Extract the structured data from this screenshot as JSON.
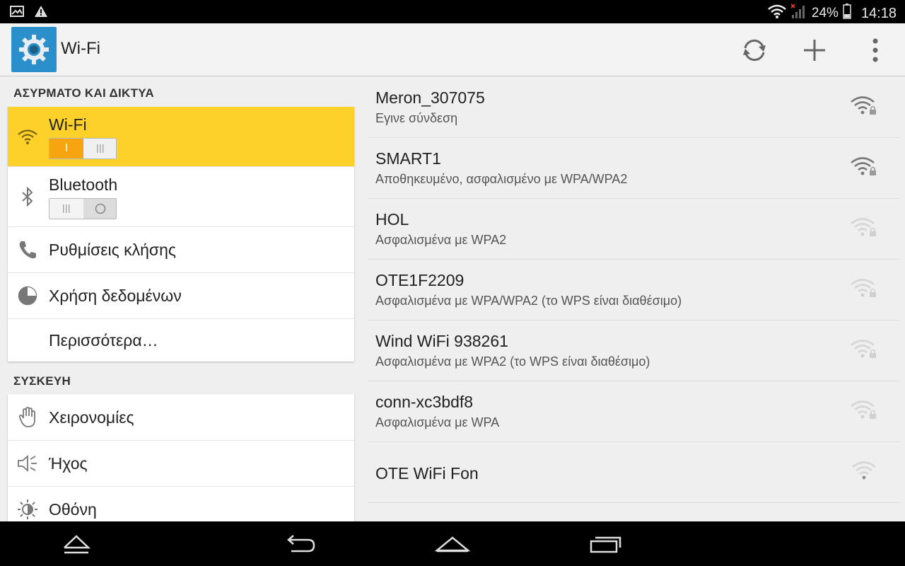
{
  "status_bar": {
    "left_icons": [
      "gallery-icon",
      "warning-icon"
    ],
    "battery": "24%",
    "time": "14:18"
  },
  "action_bar": {
    "title": "Wi-Fi",
    "icon": "settings-gear-icon",
    "actions": [
      "refresh-icon",
      "add-icon",
      "overflow-menu-icon"
    ]
  },
  "left": {
    "wireless_header": "ΑΣΥΡΜΑΤΟ ΚΑΙ ΔΙΚΤΥΑ",
    "wireless_items": [
      {
        "label": "Wi-Fi",
        "icon": "wifi-icon",
        "switch": "on",
        "switch_on_text": "I"
      },
      {
        "label": "Bluetooth",
        "icon": "bluetooth-icon",
        "switch": "off"
      },
      {
        "label": "Ρυθμίσεις κλήσης",
        "icon": "phone-icon"
      },
      {
        "label": "Χρήση δεδομένων",
        "icon": "data-usage-icon"
      },
      {
        "label": "Περισσότερα…"
      }
    ],
    "device_header": "ΣΥΣΚΕΥΗ",
    "device_items": [
      {
        "label": "Χειρονομίες",
        "icon": "hand-gesture-icon"
      },
      {
        "label": "Ήχος",
        "icon": "speaker-icon"
      },
      {
        "label": "Οθόνη",
        "icon": "brightness-icon"
      }
    ]
  },
  "networks": [
    {
      "ssid": "Meron_307075",
      "status": "Εγινε σύνδεση",
      "secured": true,
      "strength": "strong"
    },
    {
      "ssid": "SMART1",
      "status": "Αποθηκευμένο, ασφαλισμένο με WPA/WPA2",
      "secured": true,
      "strength": "strong"
    },
    {
      "ssid": "HOL",
      "status": "Ασφαλισμένα με WPA2",
      "secured": true,
      "strength": "weak"
    },
    {
      "ssid": "OTE1F2209",
      "status": "Ασφαλισμένα με WPA/WPA2 (το WPS είναι διαθέσιμο)",
      "secured": true,
      "strength": "weak"
    },
    {
      "ssid": "Wind WiFi 938261",
      "status": "Ασφαλισμένα με WPA2 (το WPS είναι διαθέσιμο)",
      "secured": true,
      "strength": "weak"
    },
    {
      "ssid": "conn-xc3bdf8",
      "status": "Ασφαλισμένα με WPA",
      "secured": true,
      "strength": "weak"
    },
    {
      "ssid": "OTE WiFi Fon",
      "status": "",
      "secured": false,
      "strength": "weak"
    }
  ],
  "nav_bar": [
    "home-up-icon",
    "back-icon",
    "home-icon",
    "recents-icon"
  ],
  "colors": {
    "selected_bg": "#fdd02a",
    "switch_on": "#f6a511",
    "app_icon_bg": "#2a8fcb"
  }
}
